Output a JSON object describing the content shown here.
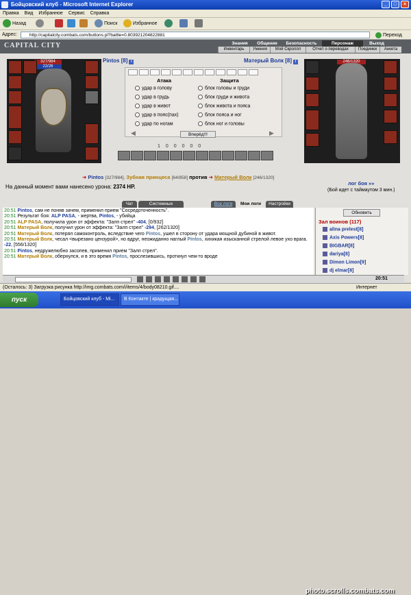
{
  "window": {
    "title": "Бойцовский клуб - Microsoft Internet Explorer"
  },
  "menu": [
    "Правка",
    "Вид",
    "Избранное",
    "Сервис",
    "Справка"
  ],
  "ietoolbar": {
    "back": "Назад",
    "search": "Поиск",
    "favorites": "Избранное"
  },
  "address": {
    "label": "Адрес:",
    "url": "http://capitalcity.combats.com/buttons.pl?battle=0.803921204822881",
    "go": "Переход"
  },
  "site": {
    "logo": "CAPITAL CITY",
    "nav_top": [
      "Знания",
      "Общение",
      "Безопасность",
      "Персонаж",
      "Выход"
    ],
    "nav_sub": [
      "Инвентарь",
      "Умения",
      "Мой Скроллл",
      "Отчет о переводах",
      "Поединки",
      "Анкета"
    ]
  },
  "player": {
    "name": "Pintos",
    "level": "[8]",
    "hp": "327/984",
    "mana": "22/26"
  },
  "enemy": {
    "name": "Матерый Волк",
    "level": "[8]",
    "hp": "246/1320"
  },
  "combat": {
    "attack_title": "Атака",
    "defense_title": "Защита",
    "attack": [
      "удар в голову",
      "удар в грудь",
      "удар в живот",
      "удар в пояс(пах)",
      "удар по ногам"
    ],
    "defense": [
      "блок головы и груди",
      "блок груди и живота",
      "блок живота и пояса",
      "блок пояса и ног",
      "блок ног и головы"
    ],
    "forward": "Вперёд!!!"
  },
  "stats": [
    "1",
    "0",
    "0",
    "0",
    "0",
    "0"
  ],
  "vs": {
    "p1": "Pintos",
    "p1hp": "[327/984],",
    "p2": "Зубная принцеса",
    "p2hp": "[64/858]",
    "mid": "против",
    "p3": "Матерый Волк",
    "p3hp": "[246/1320]"
  },
  "damage": {
    "text": "На данный момент вами нанесено урона:",
    "value": "2374 HP."
  },
  "battle_log": "лог боя »»",
  "timeout": "(Бой идет с таймаутом 3 мин.)",
  "tabs": [
    "Чат",
    "Системные сообщения",
    "Все логи",
    "Мои логи",
    "Настройки"
  ],
  "chat": [
    {
      "time": "20:51",
      "segs": [
        [
          "h",
          "Pintos"
        ],
        [
          "",
          "",
          ""
        ],
        [
          "",
          ", сам не поняв зачем, применил прием \"Сосредоточенность\"."
        ]
      ]
    },
    {
      "time": "20:51",
      "segs": [
        [
          "",
          "Результат боя: "
        ],
        [
          "h",
          "ALP PASA"
        ],
        [
          "",
          ", - жертва, "
        ],
        [
          "h",
          "Pintos"
        ],
        [
          "",
          ", - убийца"
        ]
      ]
    },
    {
      "time": "20:51",
      "segs": [
        [
          "o",
          "ALP PASA"
        ],
        [
          "",
          ", получила урон от эффекта: \"Залп стрел\" "
        ],
        [
          "h",
          "-404"
        ],
        [
          "",
          ", [0/932]"
        ]
      ]
    },
    {
      "time": "20:51",
      "segs": [
        [
          "o",
          "Матерый Волк"
        ],
        [
          "",
          ", получил урон от эффекта: \"Залп стрел\" "
        ],
        [
          "h",
          "-294"
        ],
        [
          "",
          ", [262/1320]"
        ]
      ]
    },
    {
      "time": "20:51",
      "segs": [
        [
          "o",
          "Матерый Волк"
        ],
        [
          "",
          ", потерял самоконтроль, вследствие чего "
        ],
        [
          "n",
          "Pintos"
        ],
        [
          "",
          ", ушел в сторону от удара мощной дубиной в живот."
        ]
      ]
    },
    {
      "time": "20:51",
      "segs": [
        [
          "o",
          "Матерый Волк"
        ],
        [
          "",
          ", чесал <вырезано цензурой>, но вдруг, неожиданно наглый "
        ],
        [
          "n",
          "Pintos"
        ],
        [
          "",
          ", хихикая изысканной стрелой левое ухо врага. "
        ],
        [
          "h",
          "-22"
        ],
        [
          "",
          ", [556/1320]"
        ]
      ]
    },
    {
      "time": "20:51",
      "segs": [
        [
          "h",
          "Pintos"
        ],
        [
          "",
          ", недружелюбно засопев, применил прием \"Залп стрел\"."
        ]
      ]
    },
    {
      "time": "20:51",
      "segs": [
        [
          "o",
          "Матерый Волк"
        ],
        [
          "",
          ", обернулся, и в это время "
        ],
        [
          "n",
          "Pintos"
        ],
        [
          "",
          ", прослезившись, проткнул чем-то вроде"
        ]
      ]
    }
  ],
  "right_panel": {
    "refresh": "Обновить",
    "hall_title": "Зал воинов (117)",
    "players": [
      {
        "name": "alina prelest",
        "level": "[8]"
      },
      {
        "name": "Axis Powers",
        "level": "[8]"
      },
      {
        "name": "BIGBAR",
        "level": "[8]"
      },
      {
        "name": "dariya",
        "level": "[8]"
      },
      {
        "name": "Dimon Limon",
        "level": "[9]"
      },
      {
        "name": "dj elmar",
        "level": "[8]"
      }
    ]
  },
  "clock": "20:51",
  "statusbar": "(Осталось: 3) Загрузка рисунка http://img.combats.com/i/items/4/body08210.gif....",
  "statusright": "Интернет",
  "taskbar": {
    "start": "пуск",
    "tasks": [
      "Бойцовский клуб - Mi...",
      "В Контакте | крадущая..."
    ]
  },
  "watermark": "photo.scrolls.combats.com"
}
